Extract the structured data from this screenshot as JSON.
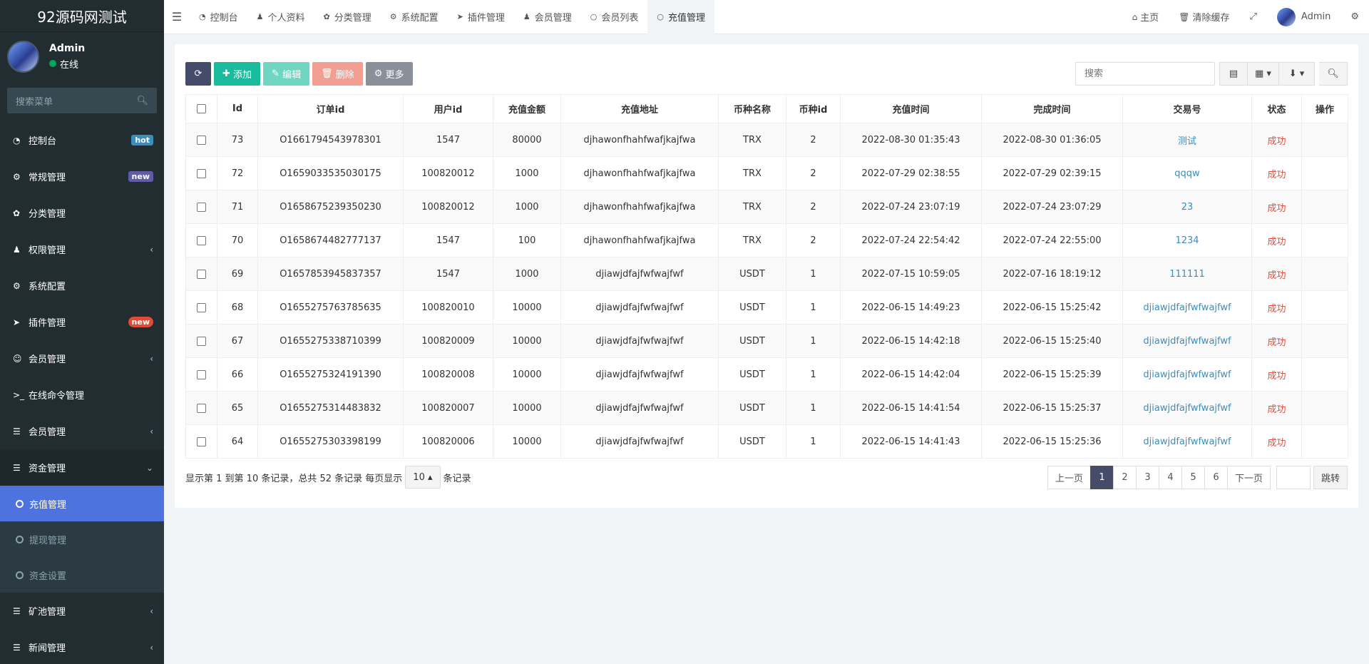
{
  "app": {
    "title": "92源码网测试"
  },
  "user": {
    "name": "Admin",
    "status": "在线"
  },
  "sidebar": {
    "search_placeholder": "搜索菜单",
    "items": [
      {
        "label": "控制台",
        "icon": "dashboard-icon",
        "badge": "hot"
      },
      {
        "label": "常规管理",
        "icon": "cogs-icon",
        "badge": "new"
      },
      {
        "label": "分类管理",
        "icon": "leaf-icon"
      },
      {
        "label": "权限管理",
        "icon": "users-icon"
      },
      {
        "label": "系统配置",
        "icon": "gear-icon"
      },
      {
        "label": "插件管理",
        "icon": "rocket-icon",
        "badge": "new"
      },
      {
        "label": "会员管理",
        "icon": "user-circle-icon"
      },
      {
        "label": "在线命令管理",
        "icon": "terminal-icon"
      },
      {
        "label": "会员管理",
        "icon": "list-icon"
      },
      {
        "label": "资金管理",
        "icon": "list-icon"
      }
    ],
    "submenu": [
      {
        "label": "充值管理"
      },
      {
        "label": "提现管理"
      },
      {
        "label": "资金设置"
      }
    ],
    "items_after": [
      {
        "label": "矿池管理",
        "icon": "list-icon"
      },
      {
        "label": "新闻管理",
        "icon": "list-icon"
      }
    ]
  },
  "topbar": {
    "tabs": [
      {
        "label": "控制台",
        "icon": "dashboard-icon"
      },
      {
        "label": "个人资料",
        "icon": "user-icon"
      },
      {
        "label": "分类管理",
        "icon": "leaf-icon"
      },
      {
        "label": "系统配置",
        "icon": "gear-icon"
      },
      {
        "label": "插件管理",
        "icon": "rocket-icon"
      },
      {
        "label": "会员管理",
        "icon": "user-icon"
      },
      {
        "label": "会员列表",
        "icon": "circle-icon"
      },
      {
        "label": "充值管理",
        "icon": "circle-icon"
      }
    ],
    "home": "主页",
    "clear_cache": "清除缓存",
    "admin": "Admin"
  },
  "toolbar": {
    "add": "添加",
    "edit": "编辑",
    "delete": "删除",
    "more": "更多",
    "search_placeholder": "搜索"
  },
  "table": {
    "headers": [
      "Id",
      "订单id",
      "用户id",
      "充值金额",
      "充值地址",
      "币种名称",
      "币种id",
      "充值时间",
      "完成时间",
      "交易号",
      "状态",
      "操作"
    ],
    "rows": [
      [
        "73",
        "O1661794543978301",
        "1547",
        "80000",
        "djhawonfhahfwafjkajfwa",
        "TRX",
        "2",
        "2022-08-30 01:35:43",
        "2022-08-30 01:36:05",
        "测试",
        "成功"
      ],
      [
        "72",
        "O1659033535030175",
        "100820012",
        "1000",
        "djhawonfhahfwafjkajfwa",
        "TRX",
        "2",
        "2022-07-29 02:38:55",
        "2022-07-29 02:39:15",
        "qqqw",
        "成功"
      ],
      [
        "71",
        "O1658675239350230",
        "100820012",
        "1000",
        "djhawonfhahfwafjkajfwa",
        "TRX",
        "2",
        "2022-07-24 23:07:19",
        "2022-07-24 23:07:29",
        "23",
        "成功"
      ],
      [
        "70",
        "O1658674482777137",
        "1547",
        "100",
        "djhawonfhahfwafjkajfwa",
        "TRX",
        "2",
        "2022-07-24 22:54:42",
        "2022-07-24 22:55:00",
        "1234",
        "成功"
      ],
      [
        "69",
        "O1657853945837357",
        "1547",
        "1000",
        "djiawjdfajfwfwajfwf",
        "USDT",
        "1",
        "2022-07-15 10:59:05",
        "2022-07-16 18:19:12",
        "111111",
        "成功"
      ],
      [
        "68",
        "O1655275763785635",
        "100820010",
        "10000",
        "djiawjdfajfwfwajfwf",
        "USDT",
        "1",
        "2022-06-15 14:49:23",
        "2022-06-15 15:25:42",
        "djiawjdfajfwfwajfwf",
        "成功"
      ],
      [
        "67",
        "O1655275338710399",
        "100820009",
        "10000",
        "djiawjdfajfwfwajfwf",
        "USDT",
        "1",
        "2022-06-15 14:42:18",
        "2022-06-15 15:25:40",
        "djiawjdfajfwfwajfwf",
        "成功"
      ],
      [
        "66",
        "O1655275324191390",
        "100820008",
        "10000",
        "djiawjdfajfwfwajfwf",
        "USDT",
        "1",
        "2022-06-15 14:42:04",
        "2022-06-15 15:25:39",
        "djiawjdfajfwfwajfwf",
        "成功"
      ],
      [
        "65",
        "O1655275314483832",
        "100820007",
        "10000",
        "djiawjdfajfwfwajfwf",
        "USDT",
        "1",
        "2022-06-15 14:41:54",
        "2022-06-15 15:25:37",
        "djiawjdfajfwfwajfwf",
        "成功"
      ],
      [
        "64",
        "O1655275303398199",
        "100820006",
        "10000",
        "djiawjdfajfwfwajfwf",
        "USDT",
        "1",
        "2022-06-15 14:41:43",
        "2022-06-15 15:25:36",
        "djiawjdfajfwfwajfwf",
        "成功"
      ]
    ]
  },
  "footer": {
    "info_prefix": "显示第 1 到第 10 条记录，总共 52 条记录 每页显示",
    "page_size": "10",
    "info_suffix": "条记录",
    "prev": "上一页",
    "next": "下一页",
    "pages": [
      "1",
      "2",
      "3",
      "4",
      "5",
      "6"
    ],
    "jump": "跳转"
  },
  "colors": {
    "sidebar_bg": "#222d32",
    "active": "#4e73df",
    "success": "#18bc9c",
    "danger": "#e74c3c",
    "link": "#3c8dbc"
  }
}
